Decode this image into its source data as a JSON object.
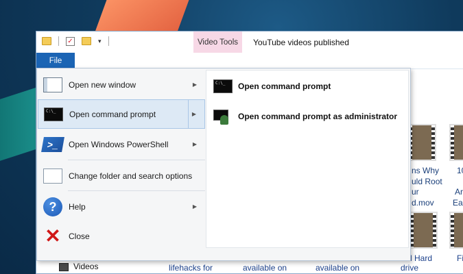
{
  "window": {
    "context_tab": "Video Tools",
    "title": "YouTube videos published",
    "file_tab": "File"
  },
  "file_menu": {
    "items": [
      {
        "label": "Open new window",
        "icon": "window-icon",
        "has_submenu": true
      },
      {
        "label": "Open command prompt",
        "icon": "command-prompt-icon",
        "has_submenu": true,
        "active": true
      },
      {
        "label": "Open Windows PowerShell",
        "icon": "powershell-icon",
        "has_submenu": true
      },
      {
        "label": "Change folder and search options",
        "icon": "folder-options-icon",
        "has_submenu": false
      },
      {
        "label": "Help",
        "icon": "help-icon",
        "has_submenu": true
      },
      {
        "label": "Close",
        "icon": "close-icon",
        "has_submenu": false
      }
    ],
    "submenu": [
      {
        "label": "Open command prompt",
        "icon": "command-prompt-icon"
      },
      {
        "label": "Open command prompt as administrator",
        "icon": "command-prompt-admin-icon"
      }
    ]
  },
  "background": {
    "thumb_texts": [
      "ns Why",
      "uld Root",
      "ur",
      "d.mov",
      "10",
      "Ar",
      "Ea"
    ],
    "bottom_texts": [
      "lifehacks for",
      "available on",
      "available on",
      "l Hard",
      "drive",
      "Fi"
    ],
    "nav_item": "Videos"
  },
  "colors": {
    "file_tab": "#1b64b4",
    "context_tab": "#f7d8e6",
    "menu_active": "#dde9f5",
    "close_red": "#d01818"
  }
}
